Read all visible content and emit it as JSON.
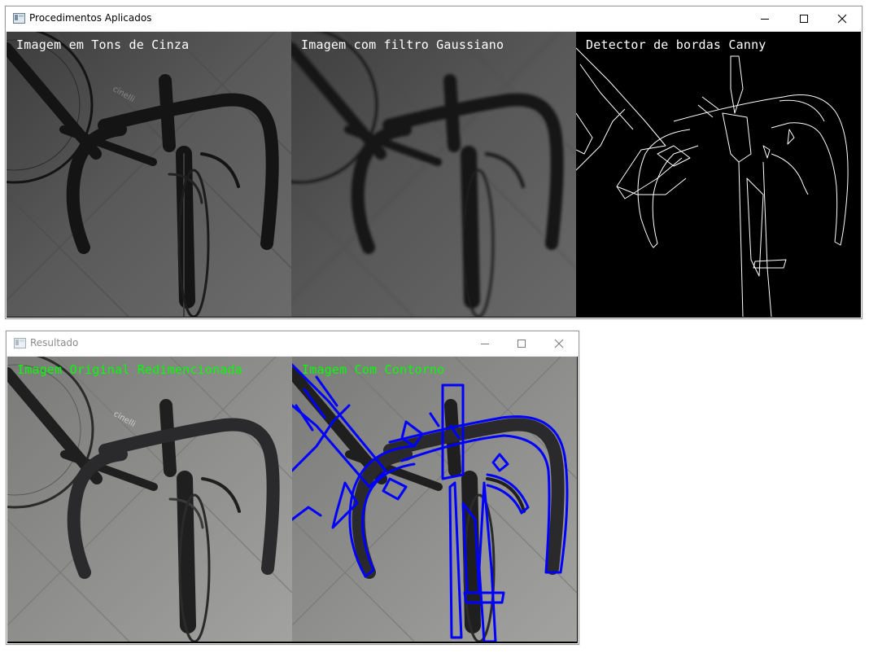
{
  "windows": {
    "main": {
      "title": "Procedimentos Aplicados",
      "panels": {
        "gray": {
          "label": "Imagem em Tons de Cinza"
        },
        "gaussian": {
          "label": "Imagem com filtro Gaussiano"
        },
        "canny": {
          "label": "Detector de bordas Canny"
        }
      }
    },
    "result": {
      "title": "Resultado",
      "panels": {
        "original": {
          "label": "Imagem Original Redimencionada"
        },
        "contour": {
          "label": "Imagem Com Contorno"
        }
      }
    }
  },
  "colors": {
    "label_white": "#ffffff",
    "label_green": "#00ff00",
    "contour_blue": "#0000ff",
    "edge_white": "#ffffff"
  },
  "icons": {
    "minimize": "minimize-icon",
    "maximize": "maximize-icon",
    "close": "close-icon",
    "app": "opencv-window-icon"
  }
}
